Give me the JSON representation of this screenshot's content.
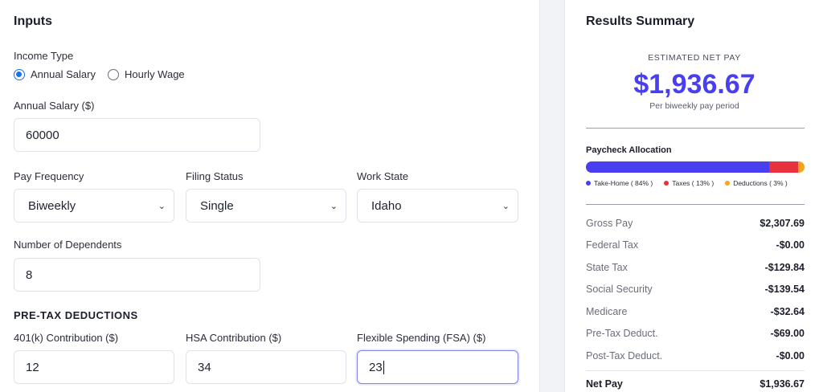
{
  "inputs": {
    "title": "Inputs",
    "income_type": {
      "label": "Income Type",
      "options": [
        "Annual Salary",
        "Hourly Wage"
      ],
      "selected": "Annual Salary"
    },
    "annual_salary": {
      "label": "Annual Salary ($)",
      "value": "60000"
    },
    "pay_frequency": {
      "label": "Pay Frequency",
      "value": "Biweekly"
    },
    "filing_status": {
      "label": "Filing Status",
      "value": "Single"
    },
    "work_state": {
      "label": "Work State",
      "value": "Idaho"
    },
    "dependents": {
      "label": "Number of Dependents",
      "value": "8"
    },
    "pretax_heading": "PRE-TAX DEDUCTIONS",
    "contrib_401k": {
      "label": "401(k) Contribution ($)",
      "value": "12"
    },
    "hsa": {
      "label": "HSA Contribution ($)",
      "value": "34"
    },
    "fsa": {
      "label": "Flexible Spending (FSA) ($)",
      "value": "23"
    }
  },
  "results": {
    "title": "Results Summary",
    "net_caption": "ESTIMATED NET PAY",
    "net_amount": "$1,936.67",
    "net_sub": "Per biweekly pay period",
    "allocation": {
      "title": "Paycheck Allocation",
      "segments": [
        {
          "name": "Take-Home",
          "label": "Take-Home ( 84% )",
          "percent": 84,
          "color": "#4a3ff0"
        },
        {
          "name": "Taxes",
          "label": "Taxes ( 13% )",
          "percent": 13,
          "color": "#e8313f"
        },
        {
          "name": "Deductions",
          "label": "Deductions ( 3% )",
          "percent": 3,
          "color": "#f4a41b"
        }
      ]
    },
    "breakdown": [
      {
        "label": "Gross Pay",
        "value": "$2,307.69"
      },
      {
        "label": "Federal Tax",
        "value": "-$0.00"
      },
      {
        "label": "State Tax",
        "value": "-$129.84"
      },
      {
        "label": "Social Security",
        "value": "-$139.54"
      },
      {
        "label": "Medicare",
        "value": "-$32.64"
      },
      {
        "label": "Pre-Tax Deduct.",
        "value": "-$69.00"
      },
      {
        "label": "Post-Tax Deduct.",
        "value": "-$0.00"
      }
    ],
    "total": {
      "label": "Net Pay",
      "value": "$1,936.67"
    }
  }
}
